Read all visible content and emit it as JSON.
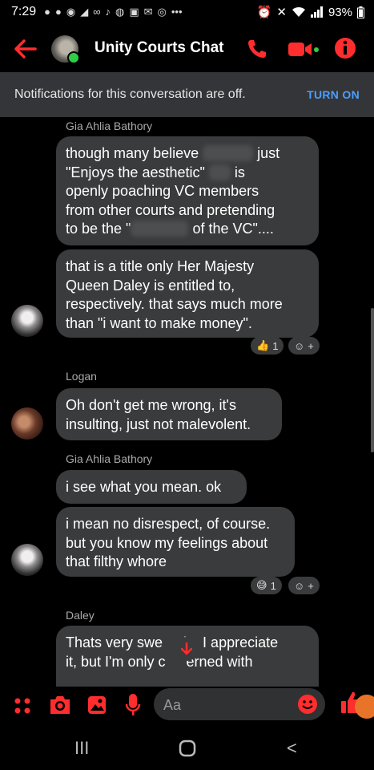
{
  "status_bar": {
    "time": "7:29",
    "battery": "93%"
  },
  "header": {
    "title": "Unity Courts Chat",
    "accent_color": "#ff2d2d"
  },
  "banner": {
    "message": "Notifications for this conversation are off.",
    "action": "TURN ON"
  },
  "messages": [
    {
      "sender": "Gia Ahlia Bathory",
      "bubbles": [
        [
          "though many believe [redacted] just",
          "\"Enjoys the aesthetic\" [redacted] is",
          "openly poaching VC members",
          "from other courts and pretending",
          "to be the \"[redacted] of the VC\"...."
        ],
        [
          "that is a title only Her Majesty",
          "Queen Daley is entitled to,",
          "respectively. that says much more",
          "than \"i want to make money\"."
        ]
      ],
      "reactions": [
        "👍",
        "1"
      ]
    },
    {
      "sender": "Logan",
      "bubbles": [
        [
          "Oh don't get me wrong, it's",
          "insulting, just not malevolent."
        ]
      ]
    },
    {
      "sender": "Gia Ahlia Bathory",
      "bubbles": [
        [
          "i see what you mean. ok"
        ],
        [
          "i mean no disrespect, of course.",
          "but you know my feelings about",
          "that filthy whore"
        ]
      ],
      "reactions": [
        "😅",
        "1"
      ]
    },
    {
      "sender": "Daley",
      "bubbles": [
        [
          "Thats very swe[...]ia. I appreciate",
          "it, but I'm only c[...]erned with"
        ]
      ]
    }
  ],
  "bubble_texts": {
    "b1_l1_a": "though many believe",
    "b1_l1_b": "just",
    "b1_l2_a": "\"Enjoys the aesthetic\"",
    "b1_l2_b": "is",
    "b1_l3": "openly poaching VC members",
    "b1_l4": "from other courts and pretending",
    "b1_l5_a": "to be the \"",
    "b1_l5_b": "of the VC\"....",
    "b2_l1": "that is a title only Her Majesty",
    "b2_l2": "Queen Daley is entitled to,",
    "b2_l3": "respectively. that says much more",
    "b2_l4": "than \"i want to make money\".",
    "b3_l1": "Oh don't get me wrong, it's",
    "b3_l2": "insulting, just not malevolent.",
    "b4_l1": "i see what you mean. ok",
    "b5_l1": "i mean no disrespect, of course.",
    "b5_l2": "but you know my feelings about",
    "b5_l3": "that filthy whore",
    "b6_l1_a": "Thats very swe",
    "b6_l1_b": "ia. I appreciate",
    "b6_l2_a": "it, but I'm only c",
    "b6_l2_b": "erned with"
  },
  "senders": {
    "s1": "Gia Ahlia Bathory",
    "s2": "Logan",
    "s3": "Gia Ahlia Bathory",
    "s4": "Daley"
  },
  "reactions": {
    "r1_emoji": "👍",
    "r1_count": "1",
    "r2_emoji": "😅",
    "r2_count": "1",
    "add": "+"
  },
  "composer": {
    "placeholder": "Aa"
  },
  "navbar": {
    "recent": "III",
    "back": "<"
  }
}
